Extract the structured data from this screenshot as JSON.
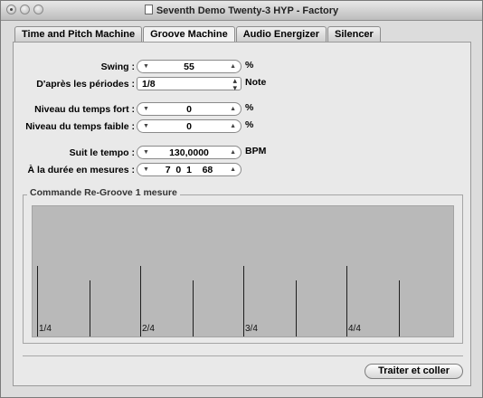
{
  "window": {
    "title": "Seventh Demo Twenty-3 HYP - Factory"
  },
  "tabs": [
    "Time and Pitch Machine",
    "Groove Machine",
    "Audio Energizer",
    "Silencer"
  ],
  "active_tab": "Groove Machine",
  "params": {
    "swing": {
      "label": "Swing :",
      "value": "55",
      "unit": "%"
    },
    "periods": {
      "label": "D'après les périodes :",
      "value": "1/8",
      "unit": "Note"
    },
    "strong": {
      "label": "Niveau du temps fort :",
      "value": "0",
      "unit": "%"
    },
    "weak": {
      "label": "Niveau du temps faible :",
      "value": "0",
      "unit": "%"
    },
    "tempo": {
      "label": "Suit le tempo :",
      "value": "130,0000",
      "unit": "BPM"
    },
    "duration": {
      "label": "À la durée en mesures :",
      "value": "7  0  1    68"
    }
  },
  "regroove": {
    "title": "Commande Re-Groove 1 mesure",
    "beats": [
      "1/4",
      "2/4",
      "3/4",
      "4/4"
    ]
  },
  "buttons": {
    "apply": "Traiter et coller"
  }
}
